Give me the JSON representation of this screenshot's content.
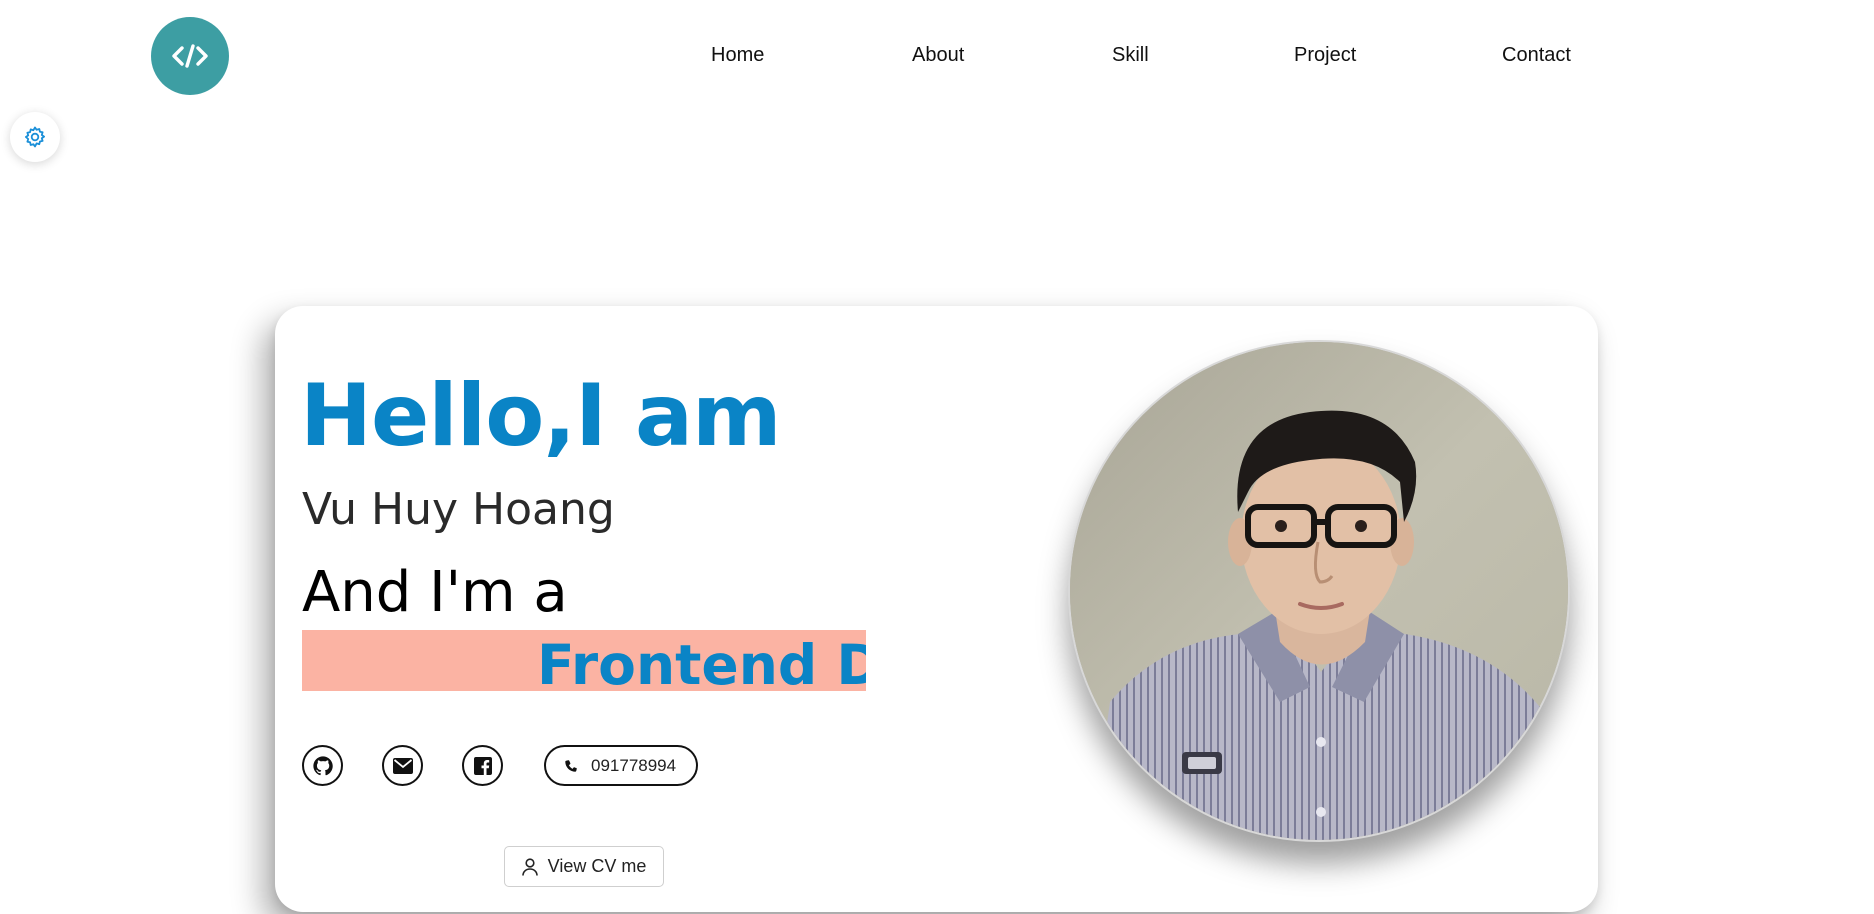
{
  "nav": {
    "items": [
      {
        "label": "Home"
      },
      {
        "label": "About"
      },
      {
        "label": "Skill"
      },
      {
        "label": "Project"
      },
      {
        "label": "Contact"
      }
    ]
  },
  "logo": {
    "icon": "code-icon",
    "color": "#3d9ea3"
  },
  "settings": {
    "icon": "gear-icon",
    "color": "#1a8fd8"
  },
  "hero": {
    "greeting": "Hello,I am",
    "name": "Vu Huy Hoang",
    "role_intro": "And I'm a",
    "role_typed": "Frontend De",
    "accent_color": "#0a84c6",
    "highlight_color": "#fbb3a3"
  },
  "socials": {
    "github_icon": "github-icon",
    "email_icon": "mail-icon",
    "facebook_icon": "facebook-icon",
    "phone_icon": "phone-icon",
    "phone": "091778994"
  },
  "cv_button": {
    "label": "View CV me",
    "icon": "user-icon"
  },
  "avatar": {
    "icon": "profile-photo"
  }
}
